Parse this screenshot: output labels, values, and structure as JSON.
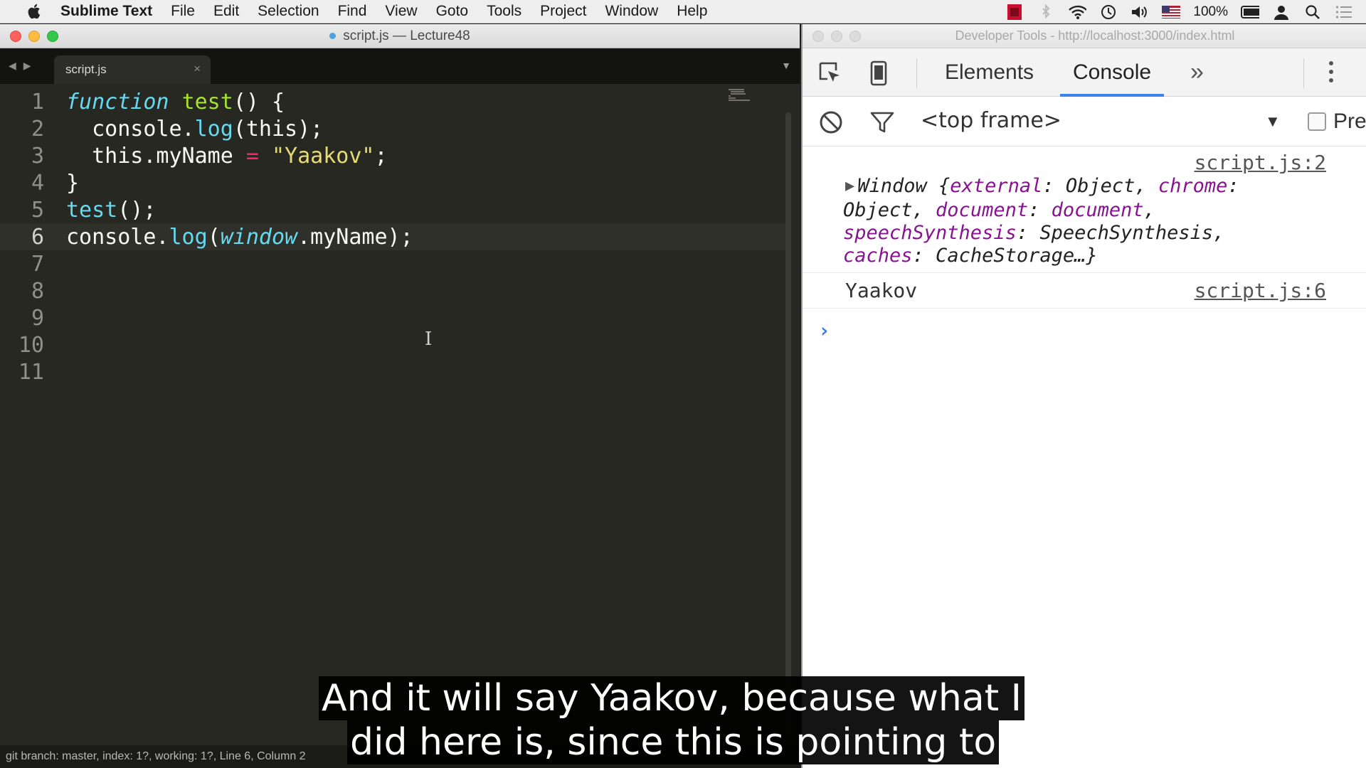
{
  "menubar": {
    "app_name": "Sublime Text",
    "items": [
      "File",
      "Edit",
      "Selection",
      "Find",
      "View",
      "Goto",
      "Tools",
      "Project",
      "Window",
      "Help"
    ],
    "battery": "100%"
  },
  "sublime": {
    "window_title": "script.js — Lecture48",
    "tab_label": "script.js",
    "tab_close": "×",
    "status_text": "git branch: master, index: 1?, working: 1?, Line 6, Column 2",
    "lines": [
      {
        "num": "1"
      },
      {
        "num": "2"
      },
      {
        "num": "3"
      },
      {
        "num": "4"
      },
      {
        "num": "5"
      },
      {
        "num": "6"
      },
      {
        "num": "7"
      },
      {
        "num": "8"
      },
      {
        "num": "9"
      },
      {
        "num": "10"
      },
      {
        "num": "11"
      }
    ],
    "code": {
      "l1_kw": "function",
      "l1_name": "test",
      "l1_rest": "() {",
      "l2_a": "  console.",
      "l2_call": "log",
      "l2_b": "(this);",
      "l3_a": "  this.myName ",
      "l3_op": "=",
      "l3_sp": " ",
      "l3_str": "\"Yaakov\"",
      "l3_end": ";",
      "l4": "}",
      "l5_call": "test",
      "l5_rest": "();",
      "l6_a": "console.",
      "l6_call": "log",
      "l6_b": "(",
      "l6_win": "window",
      "l6_c": ".myName);"
    }
  },
  "devtools": {
    "window_title": "Developer Tools - http://localhost:3000/index.html",
    "tabs": {
      "elements": "Elements",
      "console": "Console"
    },
    "more_tabs": "»",
    "frame": "<top frame>",
    "preserve_label": "Pre",
    "messages": [
      {
        "source": "script.js:2",
        "parts": {
          "prefix": "Window {",
          "k1": "external",
          "v1": ": Object, ",
          "k2": "chrome",
          "v2": ":",
          "v2b": "Object, ",
          "k3": "document",
          "v3": ": ",
          "k3b": "document",
          "v3b": ",",
          "k4": "speechSynthesis",
          "v4": ": SpeechSynthesis,",
          "k5": "caches",
          "v5": ": CacheStorage…}"
        }
      },
      {
        "source": "script.js:6",
        "text": "Yaakov"
      }
    ],
    "prompt": "›"
  },
  "subtitles": {
    "line1": "And it will say Yaakov, because what I",
    "line2": "did here is, since this is pointing to"
  },
  "colors": {
    "editor_bg": "#272822",
    "keyword_blue": "#66d9ef",
    "function_green": "#a6e22e",
    "string_yellow": "#e6db74",
    "operator_pink": "#f92672",
    "object_key_purple": "#881391",
    "active_tab_blue": "#3b82f0"
  }
}
